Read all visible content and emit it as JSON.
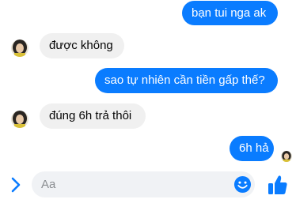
{
  "messages": [
    {
      "direction": "outgoing",
      "text": "bạn tui nga ak"
    },
    {
      "direction": "incoming",
      "text": "được không"
    },
    {
      "direction": "outgoing",
      "text": "sao tự nhiên cần tiền gấp thế?"
    },
    {
      "direction": "incoming",
      "text": "đúng 6h trả thôi"
    },
    {
      "direction": "outgoing",
      "text": "6h hả"
    }
  ],
  "composer": {
    "placeholder": "Aa",
    "expand_icon": "chevron-right-icon",
    "emoji_icon": "smiley-icon",
    "send_icon": "thumbs-up-icon"
  },
  "colors": {
    "outgoing_bubble": "#0a7cff",
    "incoming_bubble": "#f0f0f0",
    "accent": "#0a7cff",
    "input_background": "#f0f2f5"
  }
}
